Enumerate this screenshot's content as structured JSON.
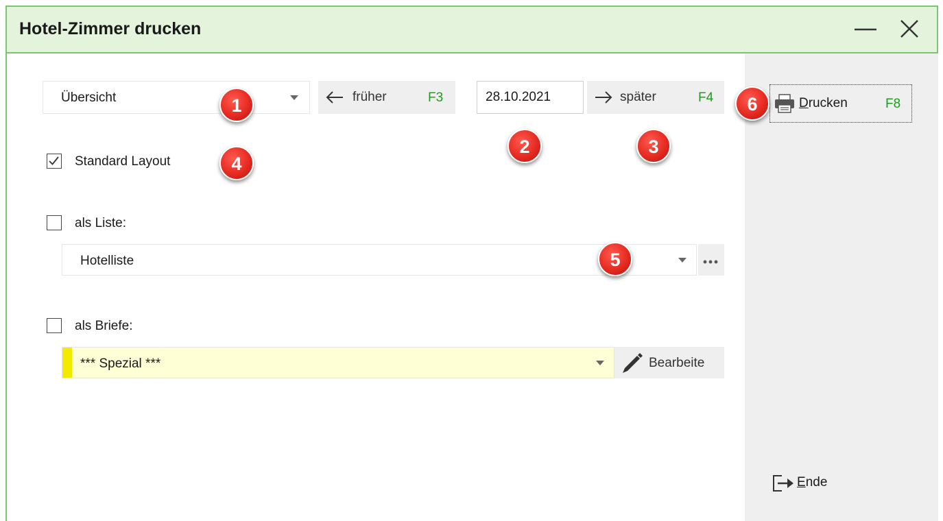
{
  "window": {
    "title": "Hotel-Zimmer drucken"
  },
  "titlebar": {
    "minimize_icon": "minimize-icon",
    "close_icon": "close-icon"
  },
  "view_select": {
    "value": "Übersicht"
  },
  "nav": {
    "earlier_label": "früher",
    "earlier_key": "F3",
    "date": "28.10.2021",
    "later_label": "später",
    "later_key": "F4"
  },
  "print": {
    "label_first": "D",
    "label_rest": "rucken",
    "key": "F8",
    "icon": "printer-icon"
  },
  "options": {
    "standard_layout": {
      "label": "Standard Layout",
      "checked": true
    },
    "as_list": {
      "label": "als Liste:",
      "checked": false,
      "value": "Hotelliste"
    },
    "as_letters": {
      "label": "als Briefe:",
      "checked": false,
      "value": "*** Spezial ***",
      "edit_label": "Bearbeite"
    }
  },
  "end": {
    "label_first": "E",
    "label_rest": "nde",
    "icon": "exit-icon"
  },
  "badges": [
    "1",
    "2",
    "3",
    "4",
    "5",
    "6"
  ],
  "colors": {
    "accent": "#7cc46f",
    "title_bg": "#e3f3dc",
    "fkey": "#1aa01a",
    "badge": "#e62b22",
    "highlight_field": "#ffffd6",
    "marker": "#f2ea00"
  }
}
